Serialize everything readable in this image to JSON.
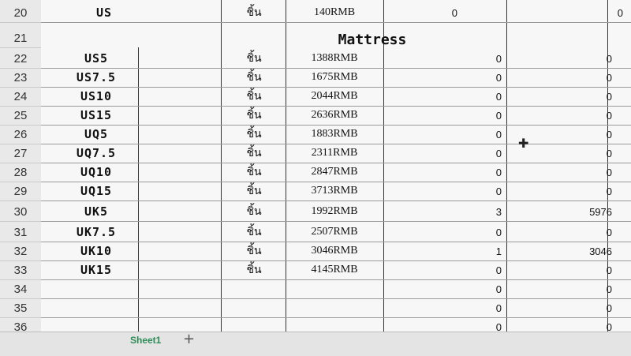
{
  "row_numbers": [
    "20",
    "21",
    "22",
    "23",
    "24",
    "25",
    "26",
    "27",
    "28",
    "29",
    "30",
    "31",
    "32",
    "33",
    "34",
    "35",
    "36"
  ],
  "row20": {
    "code": "US",
    "unit": "ชิ้น",
    "price": "140RMB",
    "qty": "0",
    "total": "0"
  },
  "section_title": "Mattress",
  "items": [
    {
      "code": "US5",
      "unit": "ชิ้น",
      "price": "1388RMB",
      "qty": "0",
      "total": "0"
    },
    {
      "code": "US7.5",
      "unit": "ชิ้น",
      "price": "1675RMB",
      "qty": "0",
      "total": "0"
    },
    {
      "code": "US10",
      "unit": "ชิ้น",
      "price": "2044RMB",
      "qty": "0",
      "total": "0"
    },
    {
      "code": "US15",
      "unit": "ชิ้น",
      "price": "2636RMB",
      "qty": "0",
      "total": "0"
    },
    {
      "code": "UQ5",
      "unit": "ชิ้น",
      "price": "1883RMB",
      "qty": "0",
      "total": "0"
    },
    {
      "code": "UQ7.5",
      "unit": "ชิ้น",
      "price": "2311RMB",
      "qty": "0",
      "total": "0"
    },
    {
      "code": "UQ10",
      "unit": "ชิ้น",
      "price": "2847RMB",
      "qty": "0",
      "total": "0"
    },
    {
      "code": "UQ15",
      "unit": "ชิ้น",
      "price": "3713RMB",
      "qty": "0",
      "total": "0"
    },
    {
      "code": "UK5",
      "unit": "ชิ้น",
      "price": "1992RMB",
      "qty": "3",
      "total": "5976"
    },
    {
      "code": "UK7.5",
      "unit": "ชิ้น",
      "price": "2507RMB",
      "qty": "0",
      "total": "0"
    },
    {
      "code": "UK10",
      "unit": "ชิ้น",
      "price": "3046RMB",
      "qty": "1",
      "total": "3046"
    },
    {
      "code": "UK15",
      "unit": "ชิ้น",
      "price": "4145RMB",
      "qty": "0",
      "total": "0"
    }
  ],
  "empty_rows": [
    {
      "qty": "0",
      "total": "0"
    },
    {
      "qty": "0",
      "total": "0"
    },
    {
      "qty": "0",
      "total": "0"
    }
  ],
  "sheet_tab": "Sheet1",
  "add_sheet_icon": "plus-icon",
  "cursor_icon": "cell-cursor-icon"
}
